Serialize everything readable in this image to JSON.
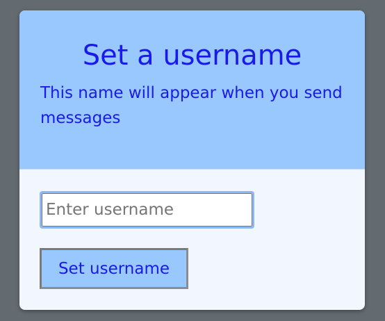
{
  "dialog": {
    "title": "Set a username",
    "subtitle": "This name will appear when you send messages",
    "input": {
      "value": "",
      "placeholder": "Enter username"
    },
    "submit_label": "Set username"
  },
  "colors": {
    "backdrop": "#636b70",
    "header_bg": "#99c8fe",
    "body_bg": "#f2f6fe",
    "text_accent": "#1a1ae8",
    "input_focus_ring": "#8ab9f5"
  }
}
